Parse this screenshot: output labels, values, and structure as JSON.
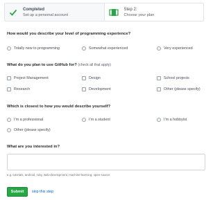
{
  "steps": [
    {
      "title": "Completed",
      "subtitle": "Set up a personal account",
      "icon": "check-icon"
    },
    {
      "title": "Step 2:",
      "subtitle": "Choose your plan",
      "icon": "book-icon"
    }
  ],
  "colors": {
    "accent": "#28a745",
    "link": "#0366d6"
  },
  "experience": {
    "question": "How would you describe your level of programming experience?",
    "options": [
      "Totally new to programming",
      "Somewhat experienced",
      "Very experienced"
    ]
  },
  "usage": {
    "question": "What do you plan to use GitHub for?",
    "note": "(check all that apply)",
    "options": [
      "Project Management",
      "Design",
      "School projects",
      "Research",
      "Development",
      "Other (please specify)"
    ]
  },
  "describe": {
    "question": "Which is closest to how you would describe yourself?",
    "options": [
      "I’m a professional",
      "I’m a student",
      "I’m a hobbyist",
      "Other (please specify)"
    ]
  },
  "interests": {
    "question": "What are you interested in?",
    "value": "",
    "hint": "e.g. tutorials, android, ruby, web-development, machine-learning, open-source"
  },
  "actions": {
    "submit": "Submit",
    "skip": "skip this step"
  }
}
